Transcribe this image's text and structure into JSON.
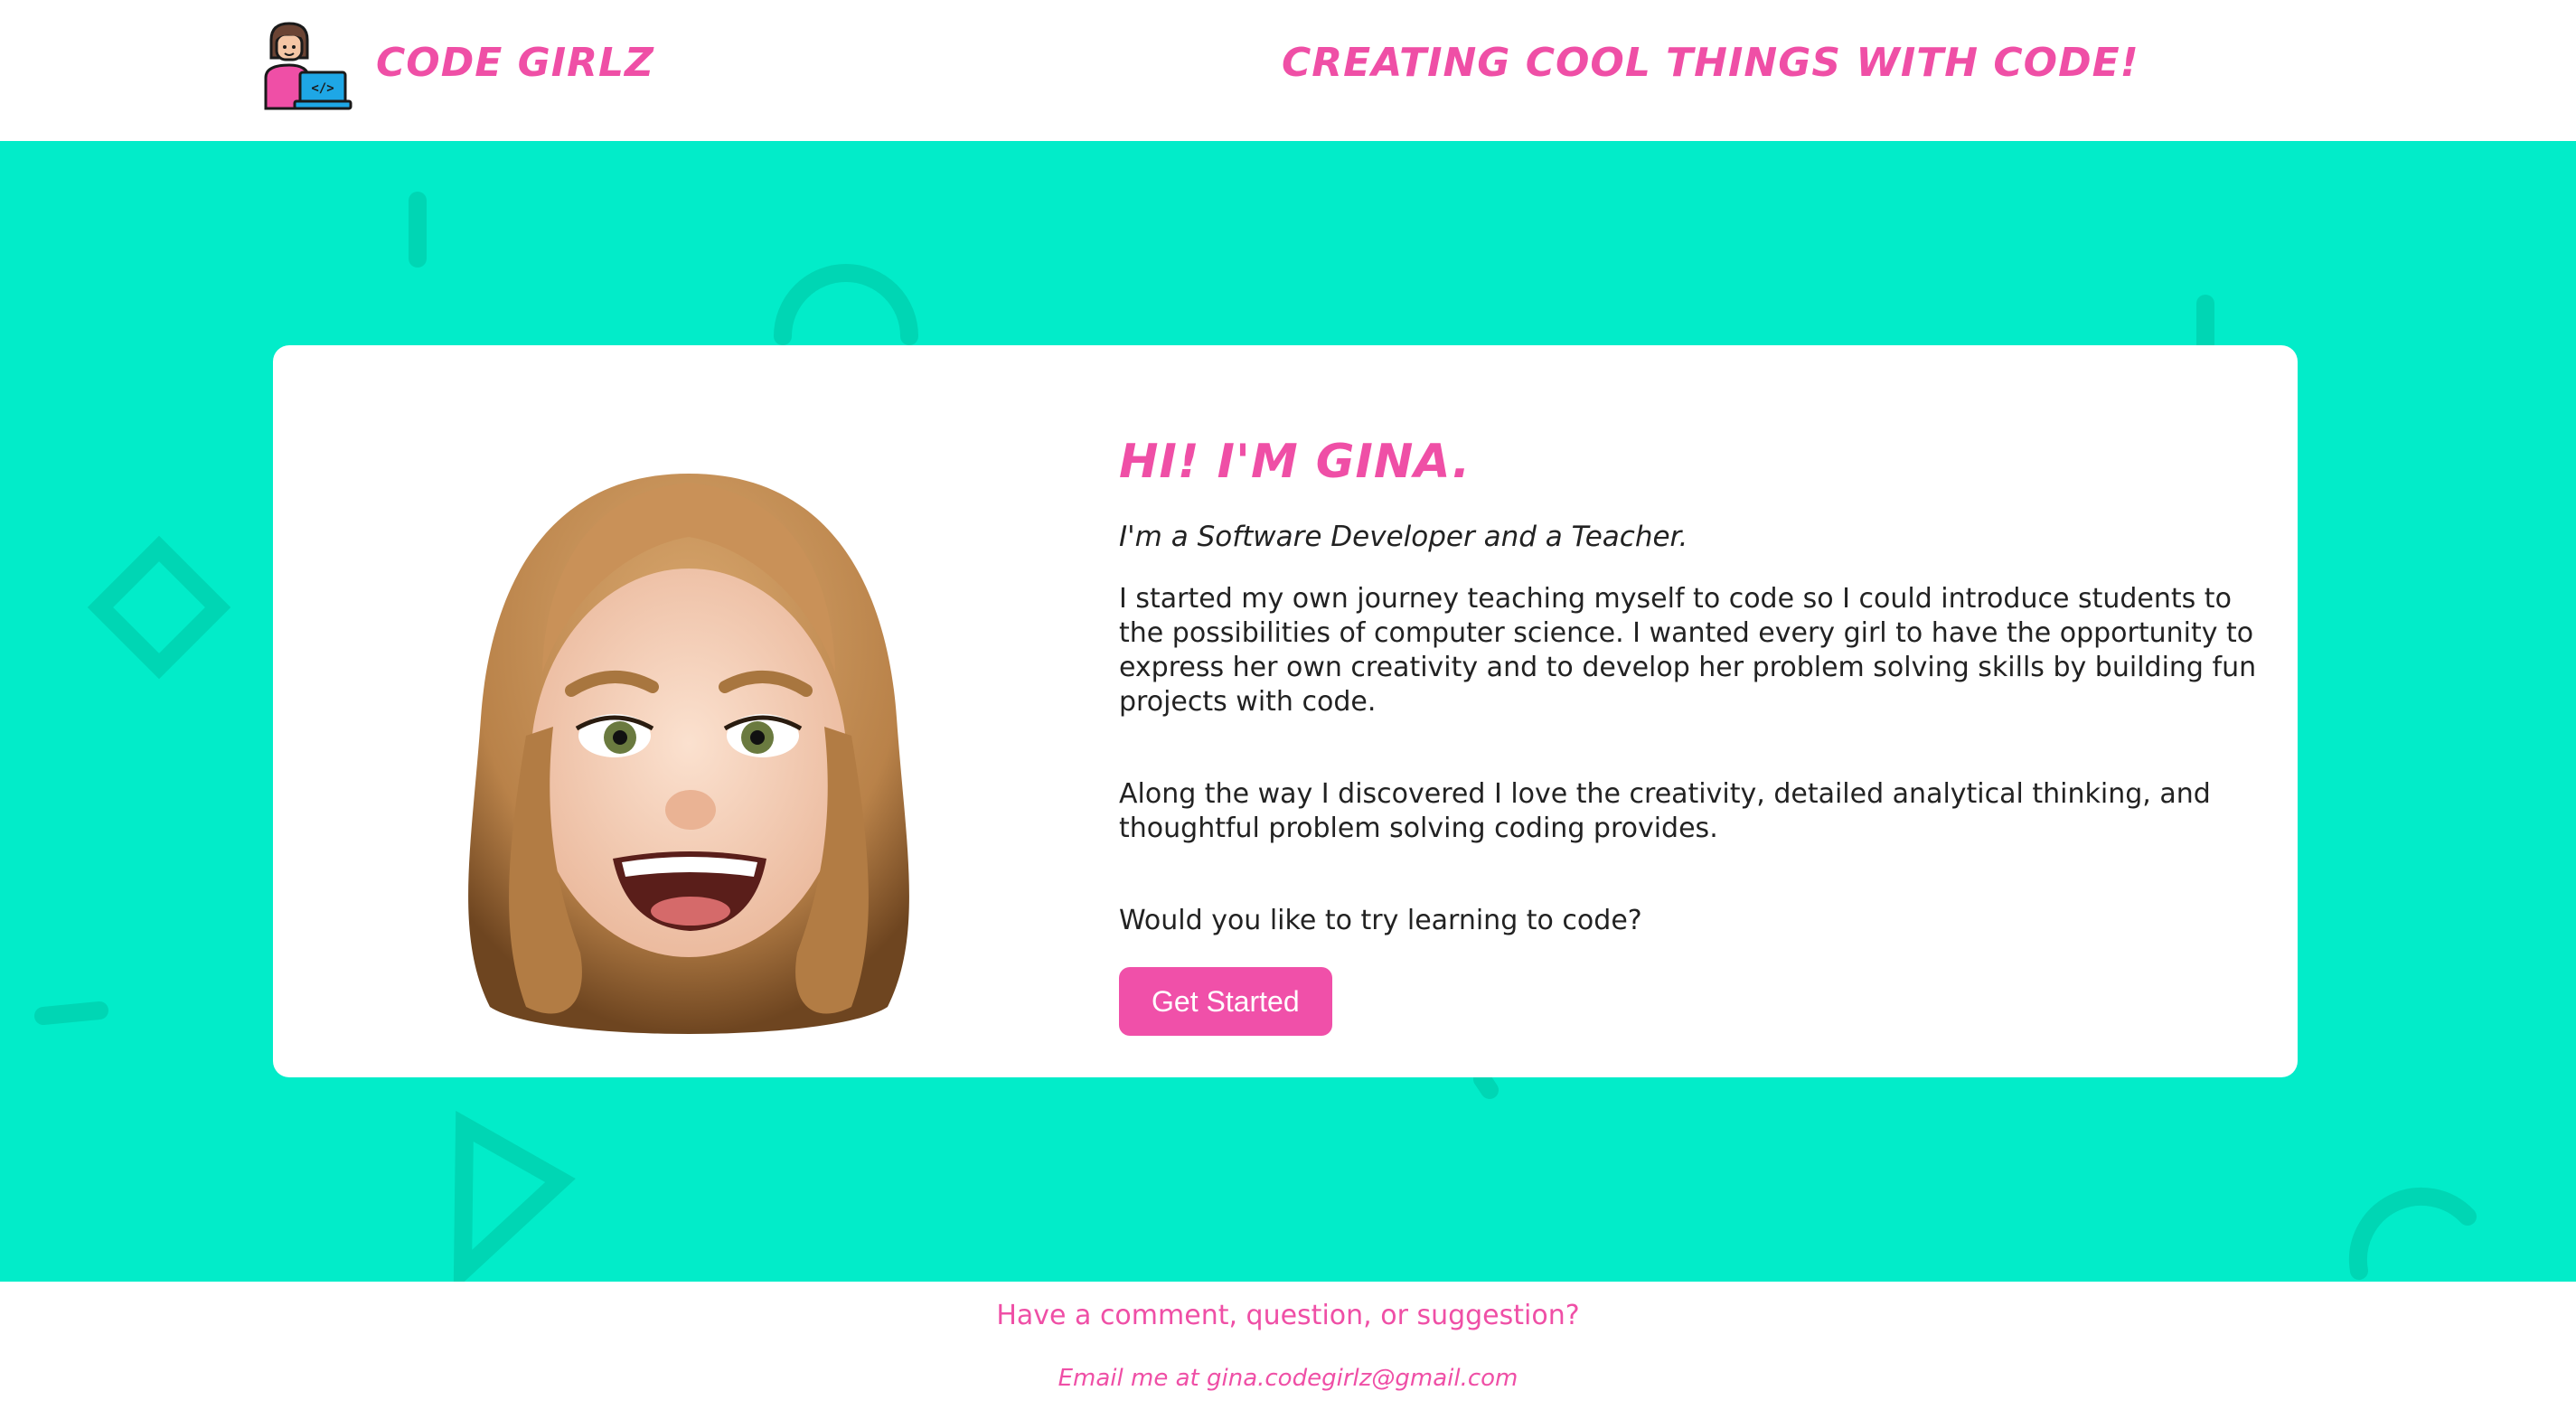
{
  "header": {
    "brand": "CODE GIRLZ",
    "tagline": "CREATING COOL THINGS WITH CODE!"
  },
  "icons": {
    "logo": "girl-with-laptop-icon",
    "avatar": "memoji-avatar"
  },
  "hero": {
    "greeting": "HI! I'M GINA.",
    "subtitle": "I'm a Software Developer and a Teacher.",
    "paragraphs": [
      "I started my own journey teaching myself to code so I could introduce students to the possibilities of computer science. I wanted every girl to have the opportunity to express her own creativity and to develop her problem solving skills by building fun projects with code.",
      "Along the way I discovered I love the creativity, detailed analytical thinking, and thoughtful problem solving coding provides.",
      "Would you like to try learning to code?"
    ],
    "cta_label": "Get Started"
  },
  "footer": {
    "question": "Have a comment, question, or suggestion?",
    "email": "Email me at gina.codegirlz@gmail.com"
  },
  "colors": {
    "accent": "#ef4fa6",
    "hero_bg": "#02ecc9",
    "button": "#f050a9"
  }
}
